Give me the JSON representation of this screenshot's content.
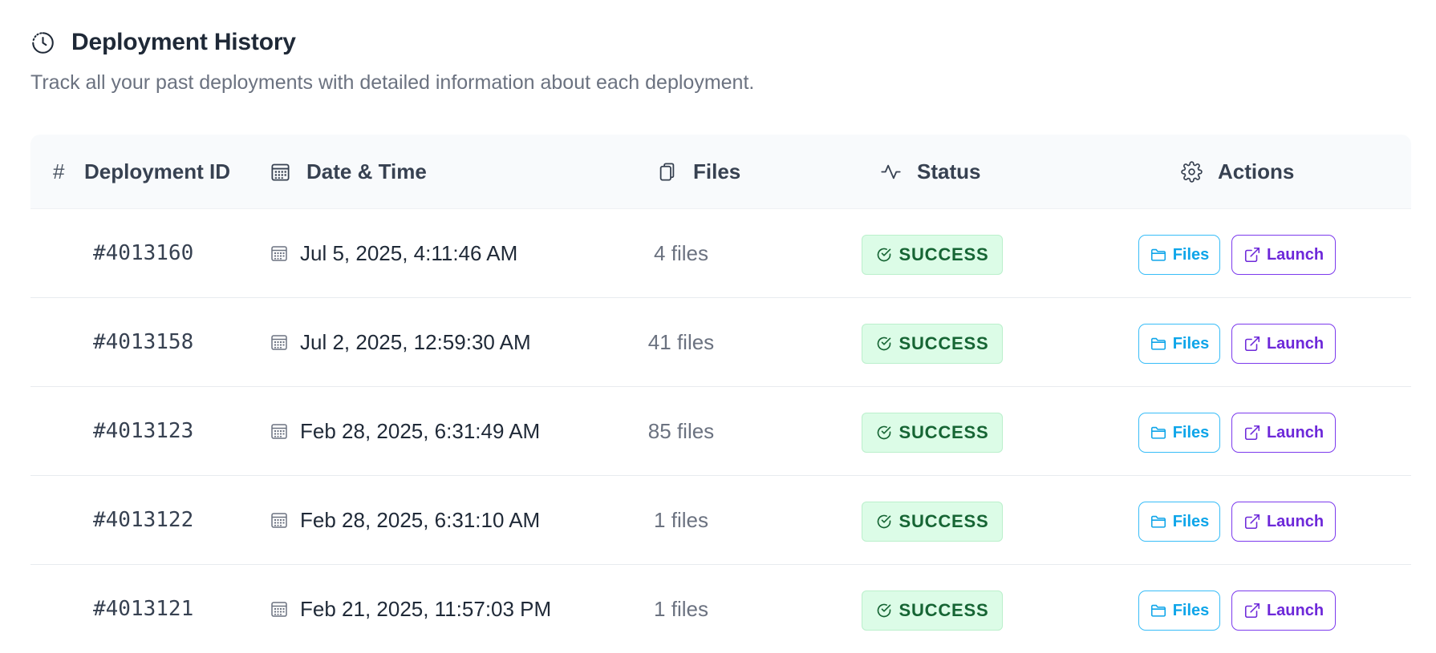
{
  "header": {
    "title": "Deployment History",
    "subtitle": "Track all your past deployments with detailed information about each deployment.",
    "icon": "clock-icon"
  },
  "table": {
    "columns": {
      "index": "#",
      "id": "Deployment ID",
      "datetime": "Date & Time",
      "files": "Files",
      "status": "Status",
      "actions": "Actions"
    },
    "rows": [
      {
        "id": "#4013160",
        "datetime": "Jul 5, 2025, 4:11:46 AM",
        "files": "4 files",
        "status": "SUCCESS",
        "files_button": "Files",
        "launch_button": "Launch"
      },
      {
        "id": "#4013158",
        "datetime": "Jul 2, 2025, 12:59:30 AM",
        "files": "41 files",
        "status": "SUCCESS",
        "files_button": "Files",
        "launch_button": "Launch"
      },
      {
        "id": "#4013123",
        "datetime": "Feb 28, 2025, 6:31:49 AM",
        "files": "85 files",
        "status": "SUCCESS",
        "files_button": "Files",
        "launch_button": "Launch"
      },
      {
        "id": "#4013122",
        "datetime": "Feb 28, 2025, 6:31:10 AM",
        "files": "1 files",
        "status": "SUCCESS",
        "files_button": "Files",
        "launch_button": "Launch"
      },
      {
        "id": "#4013121",
        "datetime": "Feb 21, 2025, 11:57:03 PM",
        "files": "1 files",
        "status": "SUCCESS",
        "files_button": "Files",
        "launch_button": "Launch"
      }
    ]
  },
  "colors": {
    "success_bg": "#dcfce7",
    "success_text": "#166534",
    "files_button": "#0ea5e9",
    "launch_button": "#6d28d9"
  }
}
